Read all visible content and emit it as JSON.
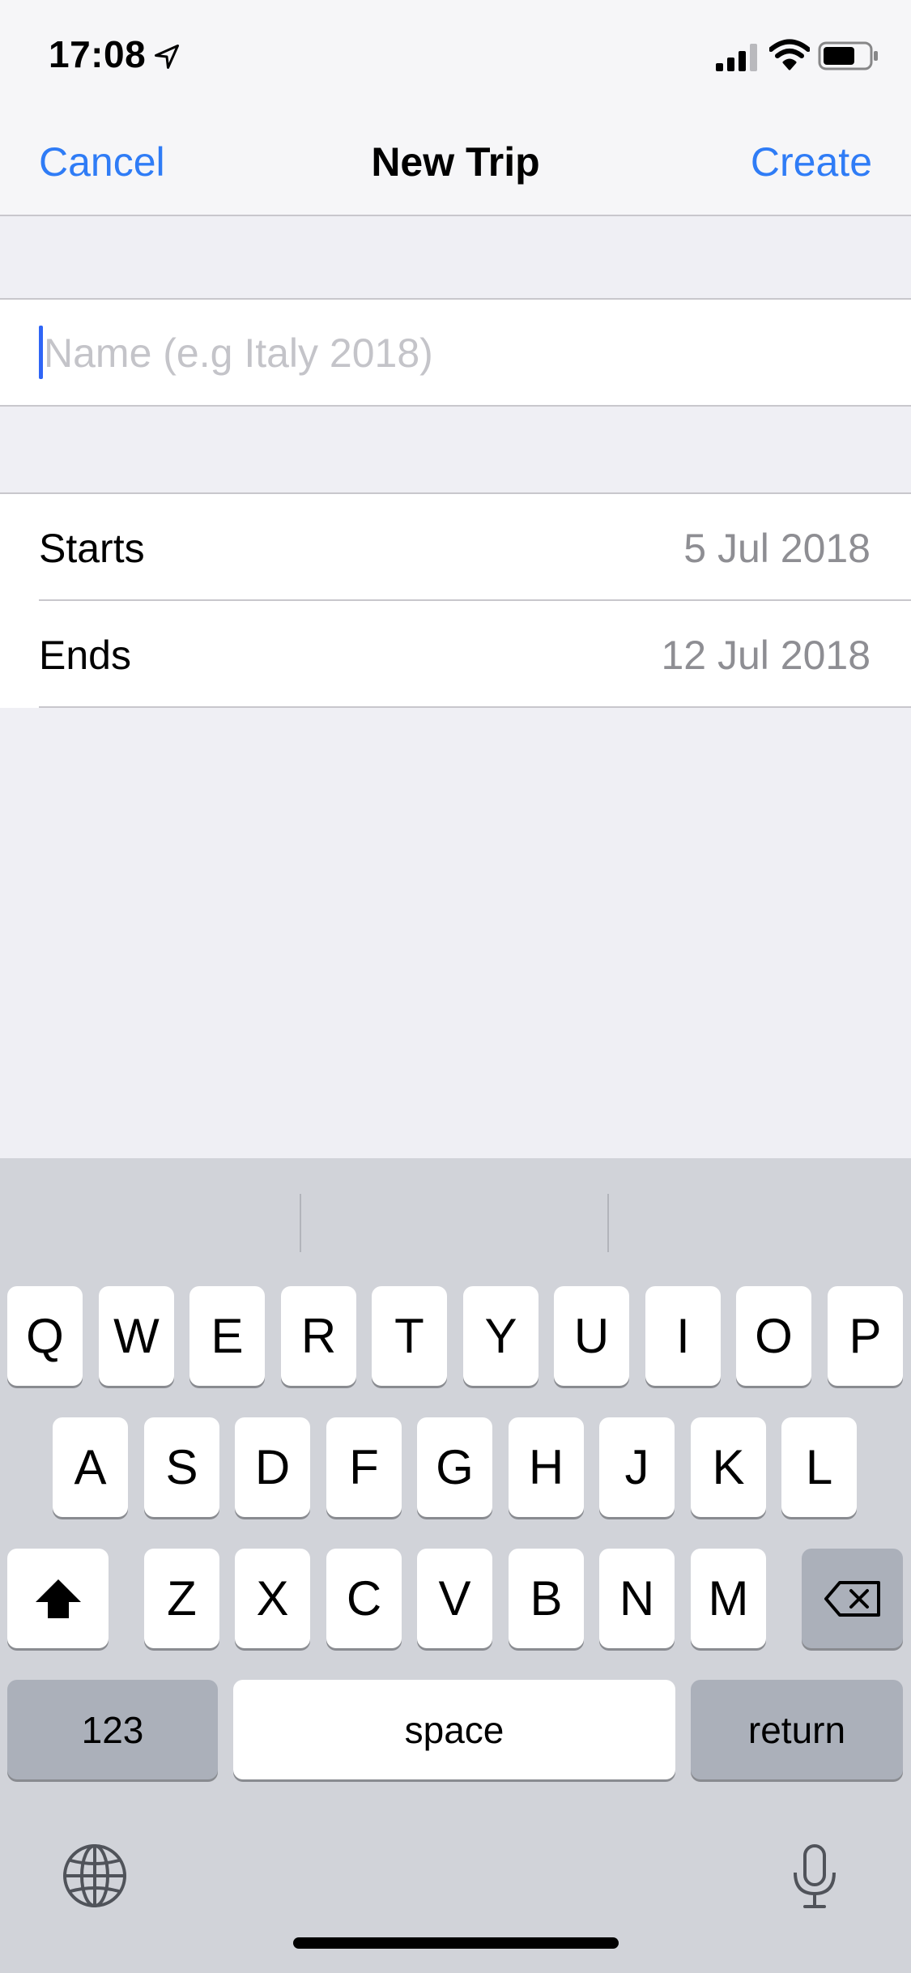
{
  "status_bar": {
    "time": "17:08",
    "icons": [
      "location-arrow-icon",
      "cellular-signal-icon",
      "wifi-icon",
      "battery-icon"
    ]
  },
  "nav": {
    "cancel_label": "Cancel",
    "title": "New Trip",
    "create_label": "Create",
    "accent_color": "#2f7cf6"
  },
  "form": {
    "name_placeholder": "Name (e.g Italy 2018)",
    "name_value": "",
    "dates": [
      {
        "label": "Starts",
        "value": "5 Jul 2018"
      },
      {
        "label": "Ends",
        "value": "12 Jul 2018"
      }
    ]
  },
  "keyboard": {
    "row1": [
      "Q",
      "W",
      "E",
      "R",
      "T",
      "Y",
      "U",
      "I",
      "O",
      "P"
    ],
    "row2": [
      "A",
      "S",
      "D",
      "F",
      "G",
      "H",
      "J",
      "K",
      "L"
    ],
    "row3": [
      "Z",
      "X",
      "C",
      "V",
      "B",
      "N",
      "M"
    ],
    "numbers_label": "123",
    "space_label": "space",
    "return_label": "return",
    "icons": [
      "shift-icon",
      "delete-icon",
      "globe-icon",
      "microphone-icon"
    ]
  }
}
